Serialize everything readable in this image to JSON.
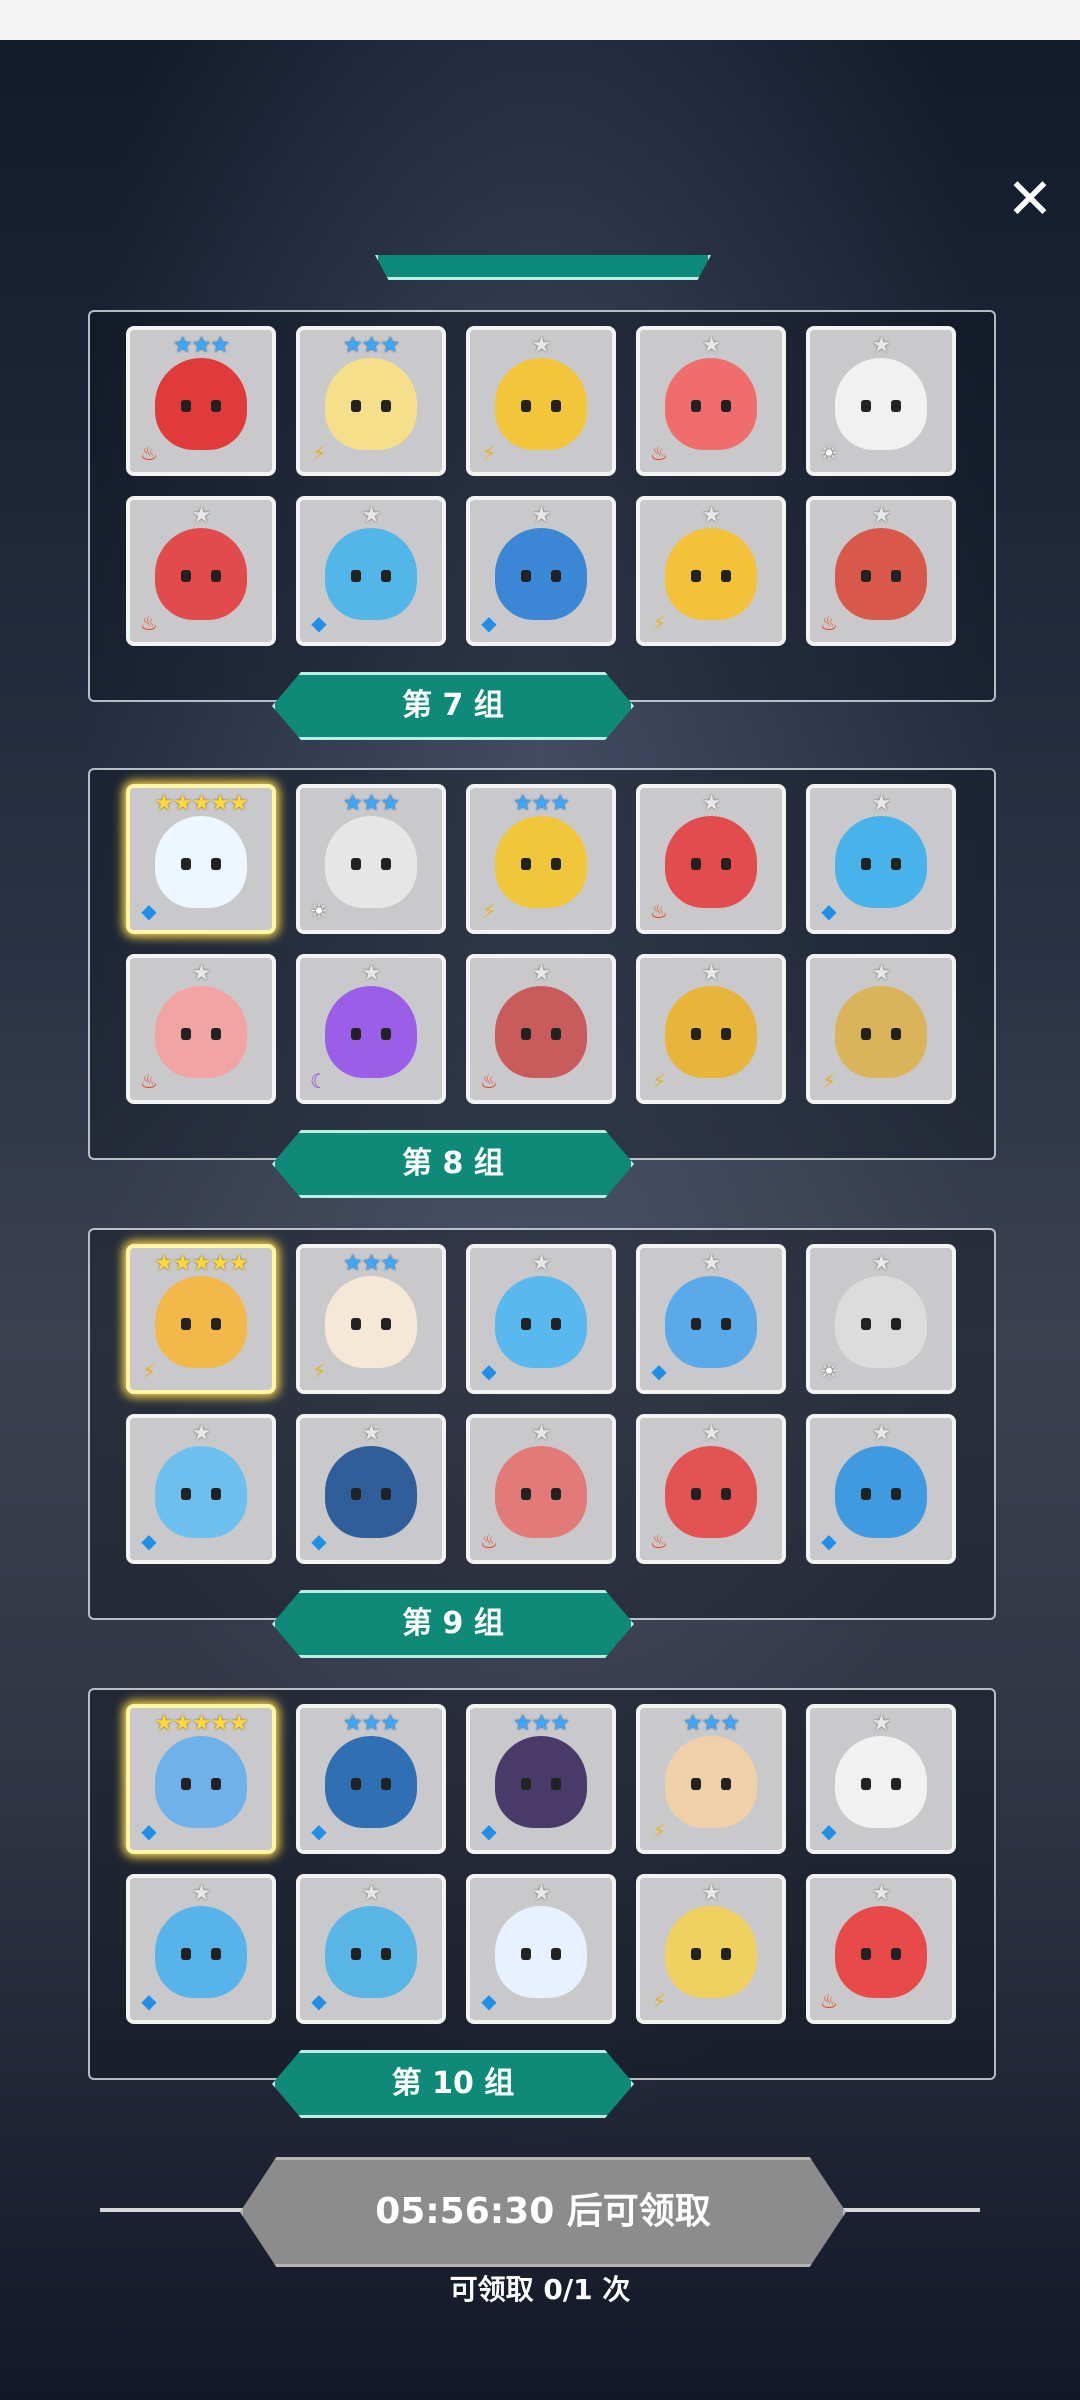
{
  "dialog": {
    "close_label": "✕",
    "groups": [
      {
        "label": "第 7 组",
        "cards": [
          {
            "stars": 3,
            "star_color": "blue",
            "element": "fire",
            "color": "#e03a3a"
          },
          {
            "stars": 3,
            "star_color": "blue",
            "element": "thunder",
            "color": "#f6df8a"
          },
          {
            "stars": 1,
            "star_color": "silver",
            "element": "thunder",
            "color": "#f2c53a"
          },
          {
            "stars": 1,
            "star_color": "silver",
            "element": "fire",
            "color": "#ef6d6d"
          },
          {
            "stars": 1,
            "star_color": "silver",
            "element": "light",
            "color": "#f1f1f1"
          },
          {
            "stars": 1,
            "star_color": "silver",
            "element": "fire",
            "color": "#e24b4b"
          },
          {
            "stars": 1,
            "star_color": "silver",
            "element": "water",
            "color": "#53b6e8"
          },
          {
            "stars": 1,
            "star_color": "silver",
            "element": "water",
            "color": "#3b87d6"
          },
          {
            "stars": 1,
            "star_color": "silver",
            "element": "thunder",
            "color": "#f3c23b"
          },
          {
            "stars": 1,
            "star_color": "silver",
            "element": "fire",
            "color": "#d8584a"
          }
        ]
      },
      {
        "label": "第 8 组",
        "cards": [
          {
            "stars": 5,
            "star_color": "gold",
            "element": "water",
            "color": "#eef6ff",
            "gold": true
          },
          {
            "stars": 3,
            "star_color": "blue",
            "element": "light",
            "color": "#e6e6e6"
          },
          {
            "stars": 3,
            "star_color": "blue",
            "element": "thunder",
            "color": "#f0c73a"
          },
          {
            "stars": 1,
            "star_color": "silver",
            "element": "fire",
            "color": "#e34c4c"
          },
          {
            "stars": 1,
            "star_color": "silver",
            "element": "water",
            "color": "#48b2ea"
          },
          {
            "stars": 1,
            "star_color": "silver",
            "element": "fire",
            "color": "#f2a3a3"
          },
          {
            "stars": 1,
            "star_color": "silver",
            "element": "dark",
            "color": "#9a5ee8"
          },
          {
            "stars": 1,
            "star_color": "silver",
            "element": "fire",
            "color": "#c85b5b"
          },
          {
            "stars": 1,
            "star_color": "silver",
            "element": "thunder",
            "color": "#e7b53a"
          },
          {
            "stars": 1,
            "star_color": "silver",
            "element": "thunder",
            "color": "#d9b45a"
          }
        ]
      },
      {
        "label": "第 9 组",
        "cards": [
          {
            "stars": 5,
            "star_color": "gold",
            "element": "thunder",
            "color": "#f2b84a",
            "gold": true
          },
          {
            "stars": 3,
            "star_color": "blue",
            "element": "thunder",
            "color": "#f5e8d6"
          },
          {
            "stars": 1,
            "star_color": "silver",
            "element": "water",
            "color": "#59b8ee"
          },
          {
            "stars": 1,
            "star_color": "silver",
            "element": "water",
            "color": "#5aa9e9"
          },
          {
            "stars": 1,
            "star_color": "silver",
            "element": "light",
            "color": "#dcdcdc"
          },
          {
            "stars": 1,
            "star_color": "silver",
            "element": "water",
            "color": "#6dc0ee"
          },
          {
            "stars": 1,
            "star_color": "silver",
            "element": "water",
            "color": "#2f5e9b"
          },
          {
            "stars": 1,
            "star_color": "silver",
            "element": "fire",
            "color": "#e27a7a"
          },
          {
            "stars": 1,
            "star_color": "silver",
            "element": "fire",
            "color": "#e35353"
          },
          {
            "stars": 1,
            "star_color": "silver",
            "element": "water",
            "color": "#3f9ae0"
          }
        ]
      },
      {
        "label": "第 10 组",
        "cards": [
          {
            "stars": 5,
            "star_color": "gold",
            "element": "water",
            "color": "#6fb2ea",
            "gold": true
          },
          {
            "stars": 3,
            "star_color": "blue",
            "element": "water",
            "color": "#2f6fb3"
          },
          {
            "stars": 3,
            "star_color": "blue",
            "element": "water",
            "color": "#4a3a6a"
          },
          {
            "stars": 3,
            "star_color": "blue",
            "element": "thunder",
            "color": "#f0d0a8"
          },
          {
            "stars": 1,
            "star_color": "silver",
            "element": "water",
            "color": "#f1f1f1"
          },
          {
            "stars": 1,
            "star_color": "silver",
            "element": "water",
            "color": "#57b3ea"
          },
          {
            "stars": 1,
            "star_color": "silver",
            "element": "water",
            "color": "#59b5e6"
          },
          {
            "stars": 1,
            "star_color": "silver",
            "element": "water",
            "color": "#e8f1ff"
          },
          {
            "stars": 1,
            "star_color": "silver",
            "element": "thunder",
            "color": "#f0d060"
          },
          {
            "stars": 1,
            "star_color": "silver",
            "element": "fire",
            "color": "#e84a4a"
          }
        ]
      }
    ],
    "claim_button_label": "05:56:30 后可领取",
    "claim_count_text": "可领取 0/1 次"
  }
}
